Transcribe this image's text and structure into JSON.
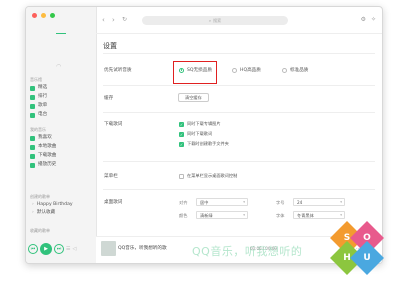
{
  "sidebar": {
    "section_music": "音乐馆",
    "music_items": [
      {
        "label": "精选",
        "icon": "music-hall-icon"
      },
      {
        "label": "排行",
        "icon": "ranking-icon"
      },
      {
        "label": "歌单",
        "icon": "playlist-icon"
      },
      {
        "label": "电台",
        "icon": "radio-icon"
      }
    ],
    "section_mine": "我的音乐",
    "mine_items": [
      {
        "label": "我喜欢",
        "icon": "heart-icon"
      },
      {
        "label": "本地歌曲",
        "icon": "computer-icon"
      },
      {
        "label": "下载歌曲",
        "icon": "download-icon"
      },
      {
        "label": "播放历史",
        "icon": "history-icon"
      }
    ],
    "section_created": "创建的歌单",
    "created_playlists": [
      "Happy Birthday",
      "默认收藏"
    ],
    "section_collected": "收藏的歌单"
  },
  "topbar": {
    "back": "‹",
    "forward": "›",
    "refresh": "↻",
    "search_placeholder": "搜索"
  },
  "settings": {
    "title": "设置",
    "quality": {
      "label": "优先试听音质",
      "options": [
        {
          "label": "SQ无损品质",
          "checked": true
        },
        {
          "label": "HQ高品质",
          "checked": false
        },
        {
          "label": "标准品质",
          "checked": false
        }
      ]
    },
    "cache": {
      "label": "缓存",
      "button": "清空缓存"
    },
    "lyrics_download": {
      "label": "下载歌词",
      "options": [
        "同时下载专辑图片",
        "同时下载歌词",
        "下载时创建歌手文件夹"
      ]
    },
    "menubar": {
      "label": "菜单栏",
      "option": "在菜单栏显示桌面歌词控制"
    },
    "desktop_lyrics": {
      "label": "桌面歌词",
      "align_label": "对齐",
      "align_value": "居中",
      "size_label": "字号",
      "size_value": "24",
      "color_label": "颜色",
      "color_value": "清新绿",
      "font_label": "字体",
      "font_value": "冬青黑体"
    }
  },
  "player": {
    "song": "QQ音乐，听我想听的歌",
    "lyric": "QQ音乐，听我想听的",
    "time": "00:00 / 00:00"
  },
  "watermark": [
    "S",
    "O",
    "H",
    "U"
  ],
  "colors": {
    "accent": "#31c27c",
    "highlight": "#e02020",
    "badge_orange": "#f39b2f",
    "badge_pink": "#e85a8c",
    "badge_blue": "#4aa8e0",
    "badge_green": "#8cc63f"
  }
}
